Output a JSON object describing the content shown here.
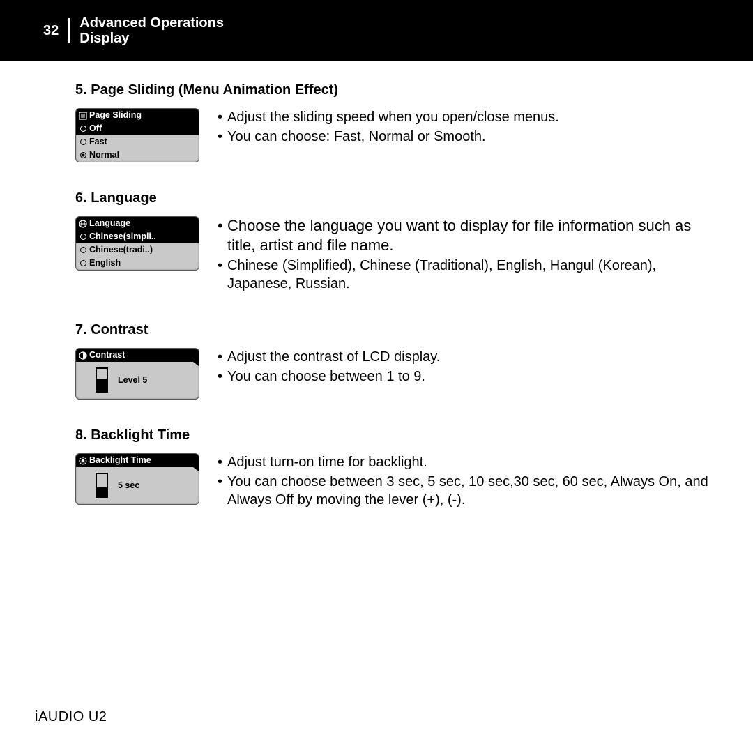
{
  "header": {
    "page_number": "32",
    "title": "Advanced Operations",
    "subtitle": "Display"
  },
  "sections": {
    "page_sliding": {
      "heading": "5. Page Sliding (Menu Animation Effect)",
      "lcd_title": "Page Sliding",
      "opt_off": "Off",
      "opt_fast": "Fast",
      "opt_normal": "Normal",
      "bullet1": "Adjust the sliding speed when you open/close menus.",
      "bullet2": "You can choose: Fast, Normal or Smooth."
    },
    "language": {
      "heading": "6. Language",
      "lcd_title": "Language",
      "opt_simpl": "Chinese(simpli..",
      "opt_trad": "Chinese(tradi..)",
      "opt_eng": "English",
      "bullet1": "Choose the language you want to display for file information such as title, artist and file name.",
      "bullet2": "Chinese (Simplified), Chinese (Traditional), English, Hangul (Korean), Japanese, Russian."
    },
    "contrast": {
      "heading": "7. Contrast",
      "lcd_title": "Contrast",
      "value_label": "Level 5",
      "bullet1": "Adjust the contrast of LCD display.",
      "bullet2": "You can choose between 1 to 9."
    },
    "backlight": {
      "heading": "8. Backlight Time",
      "lcd_title": "Backlight Time",
      "value_label": "5 sec",
      "bullet1": "Adjust turn-on time for backlight.",
      "bullet2": "You can choose between 3 sec, 5 sec, 10 sec,30 sec, 60 sec, Always On, and Always Off by moving the lever (+), (-)."
    }
  },
  "footer": "iAUDIO U2"
}
